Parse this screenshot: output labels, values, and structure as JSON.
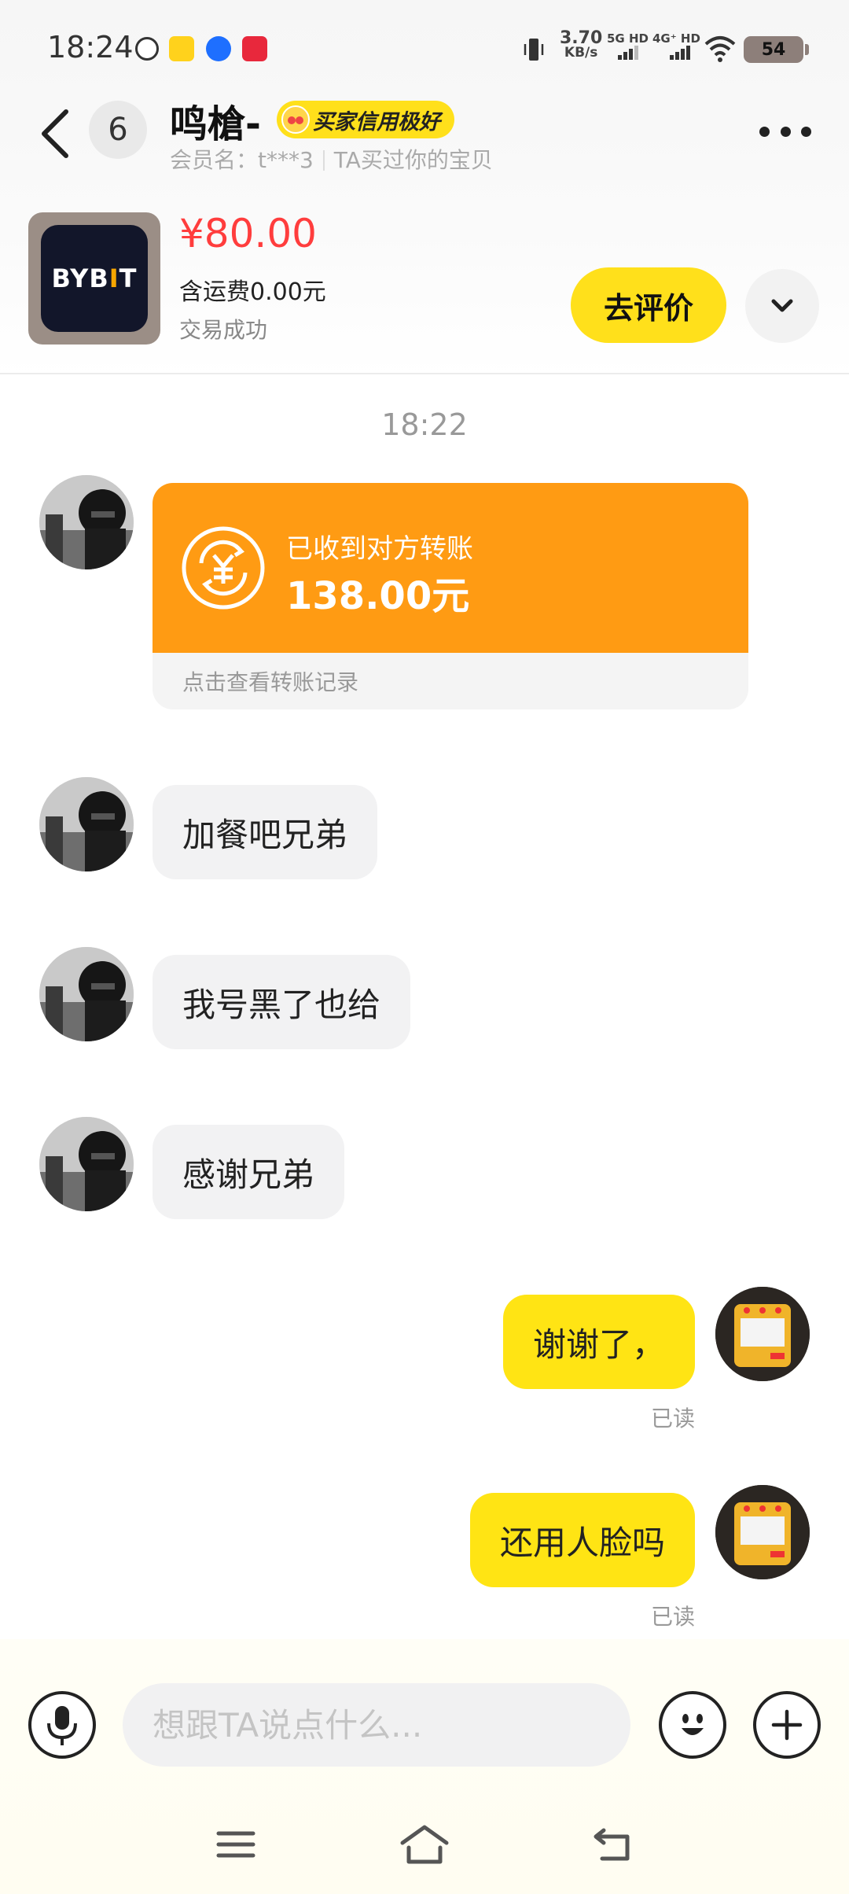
{
  "status_bar": {
    "time": "18:24",
    "net_speed_value": "3.70",
    "net_speed_unit": "KB/s",
    "sim1": "5G HD",
    "sim2": "4G⁺ HD",
    "battery": "54",
    "icons": [
      "fish-app-icon",
      "k-app-icon",
      "heart-app-icon",
      "vibrate-icon",
      "wifi-icon"
    ]
  },
  "header": {
    "unread_count": "6",
    "contact_name": "鸣槍-",
    "credit_badge": "买家信用极好",
    "member_label": "会员名：t***3",
    "member_note": "TA买过你的宝贝"
  },
  "product": {
    "thumb_text_a": "BYB",
    "thumb_text_b": "I",
    "thumb_text_c": "T",
    "price": "¥80.00",
    "shipping": "含运费0.00元",
    "status": "交易成功",
    "review_button": "去评价"
  },
  "chat": {
    "time_divider": "18:22",
    "transfer": {
      "title": "已收到对方转账",
      "amount": "138.00元",
      "footer": "点击查看转账记录"
    },
    "messages_left": [
      "加餐吧兄弟",
      "我号黑了也给",
      "感谢兄弟"
    ],
    "messages_right": [
      {
        "text": "谢谢了，",
        "status": "已读"
      },
      {
        "text": "还用人脸吗",
        "status": "已读"
      }
    ]
  },
  "input_bar": {
    "placeholder": "想跟TA说点什么..."
  },
  "colors": {
    "accent_yellow": "#ffe414",
    "price_red": "#ff3d3d",
    "transfer_orange": "#ff9b13"
  }
}
